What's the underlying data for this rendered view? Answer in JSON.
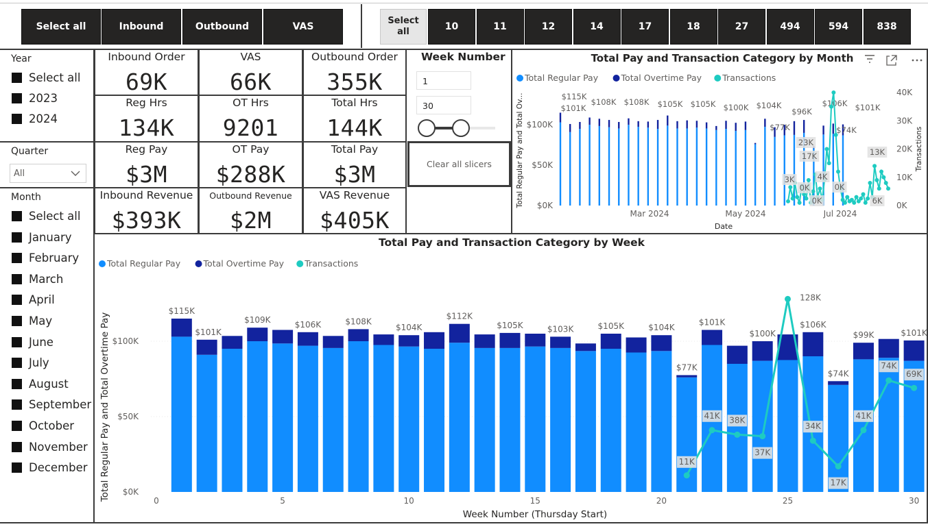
{
  "colors": {
    "regular_pay": "#118dff",
    "overtime_pay": "#12239e",
    "transactions": "#1ecbc1",
    "button_dark": "#252423",
    "button_light": "#e6e6e6",
    "divider": "#3b3b3b"
  },
  "category_buttons": [
    "Select all",
    "Inbound",
    "Outbound",
    "VAS"
  ],
  "number_buttons": {
    "select_all": "Select all",
    "values": [
      "10",
      "11",
      "12",
      "14",
      "17",
      "18",
      "27",
      "494",
      "594",
      "838"
    ]
  },
  "year_slicer": {
    "title": "Year",
    "items": [
      "Select all",
      "2023",
      "2024"
    ]
  },
  "quarter_slicer": {
    "title": "Quarter",
    "selected": "All",
    "icon": "chevron-down-icon"
  },
  "month_slicer": {
    "title": "Month",
    "items": [
      "Select all",
      "January",
      "February",
      "March",
      "April",
      "May",
      "June",
      "July",
      "August",
      "September",
      "October",
      "November",
      "December"
    ]
  },
  "kpis": [
    {
      "label": "Inbound Order",
      "value": "69K"
    },
    {
      "label": "VAS",
      "value": "66K"
    },
    {
      "label": "Outbound Order",
      "value": "355K"
    },
    {
      "label": "Reg Hrs",
      "value": "134K"
    },
    {
      "label": "OT Hrs",
      "value": "9201"
    },
    {
      "label": "Total Hrs",
      "value": "144K"
    },
    {
      "label": "Reg Pay",
      "value": "$3M"
    },
    {
      "label": "OT Pay",
      "value": "$288K"
    },
    {
      "label": "Total Pay",
      "value": "$3M"
    },
    {
      "label": "Inbound Revenue",
      "value": "$393K"
    },
    {
      "label": "Outbound Revenue",
      "value": "$2M"
    },
    {
      "label": "VAS Revenue",
      "value": "$405K"
    }
  ],
  "week_slicer": {
    "title": "Week Number",
    "min_value": "1",
    "max_value": "30",
    "range_fraction": [
      0.0,
      0.5
    ]
  },
  "clear_button": "Clear all slicers",
  "legend": [
    "Total Regular Pay",
    "Total Overtime Pay",
    "Transactions"
  ],
  "chart_data": [
    {
      "type": "bar",
      "title": "Total Pay and Transaction Category by Month",
      "xlabel": "Date",
      "ylabel": "Total Regular Pay and Total Ov...",
      "y2label": "Transactions",
      "x_ticks": [
        "Mar 2024",
        "May 2024",
        "Jul 2024"
      ],
      "y_ticks": [
        "$0K",
        "$50K",
        "$100K"
      ],
      "y2_ticks": [
        "0K",
        "10K",
        "20K",
        "30K",
        "40K"
      ],
      "ylim": [
        0,
        140000
      ],
      "y2lim": [
        0,
        40000
      ],
      "header_icons": [
        "filter-icon",
        "focus-mode-icon",
        "more-options-icon"
      ],
      "bar_labels": [
        "$115K",
        "$101K",
        "$108K",
        "$108K",
        "$105K",
        "$105K",
        "$100K",
        "$104K",
        "$77K",
        "$96K",
        "$106K",
        "$74K",
        "$101K"
      ],
      "transaction_labels": [
        "23K",
        "17K",
        "4K",
        "3K",
        "0K",
        "0K",
        "0K",
        "13K",
        "6K"
      ],
      "series": [
        {
          "name": "Total Regular Pay",
          "values": [
            103000,
            91000,
            95000,
            100000,
            98500,
            97000,
            95500,
            100000,
            97500,
            96500,
            95000,
            99000,
            95500,
            95500,
            96500,
            95500,
            93500,
            95000,
            92500,
            93500,
            76000,
            97500,
            85000,
            87000,
            87500,
            90000,
            71000,
            88000,
            89000,
            87000
          ]
        },
        {
          "name": "Total Overtime Pay",
          "values": [
            12000,
            10000,
            8500,
            9000,
            9000,
            9000,
            8000,
            8000,
            7000,
            7500,
            11000,
            12500,
            9000,
            10000,
            8500,
            7500,
            5000,
            10000,
            10000,
            10500,
            1500,
            10000,
            12000,
            13000,
            17000,
            16000,
            2500,
            11000,
            12500,
            13500
          ]
        }
      ]
    },
    {
      "type": "bar",
      "title": "Total Pay and Transaction Category by Week",
      "xlabel": "Week Number (Thursday Start)",
      "ylabel": "Total Regular Pay and Total Overtime Pay",
      "x_ticks": [
        "0",
        "5",
        "10",
        "15",
        "20",
        "25",
        "30"
      ],
      "y_ticks": [
        "$0K",
        "$50K",
        "$100K"
      ],
      "ylim": [
        0,
        140000
      ],
      "x": [
        1,
        2,
        3,
        4,
        5,
        6,
        7,
        8,
        9,
        10,
        11,
        12,
        13,
        14,
        15,
        16,
        17,
        18,
        19,
        20,
        21,
        22,
        23,
        24,
        25,
        26,
        27,
        28,
        29,
        30
      ],
      "series": [
        {
          "name": "Total Regular Pay",
          "values": [
            103000,
            91000,
            95000,
            100000,
            98500,
            97000,
            95500,
            100000,
            97500,
            96500,
            95000,
            99000,
            95500,
            95500,
            96500,
            95500,
            93500,
            95000,
            92500,
            93500,
            76000,
            97500,
            85000,
            87000,
            87500,
            90000,
            71000,
            88000,
            89000,
            87000
          ]
        },
        {
          "name": "Total Overtime Pay",
          "values": [
            12000,
            10000,
            8500,
            9000,
            9000,
            9000,
            8000,
            8000,
            7000,
            7500,
            11000,
            12500,
            9000,
            10000,
            8500,
            7500,
            5000,
            10000,
            10000,
            10500,
            1500,
            10000,
            12000,
            13000,
            17000,
            16000,
            2500,
            11000,
            12500,
            13500
          ]
        }
      ],
      "bar_labels": [
        {
          "week": 1,
          "text": "$115K"
        },
        {
          "week": 2,
          "text": "$101K"
        },
        {
          "week": 4,
          "text": "$109K"
        },
        {
          "week": 6,
          "text": "$106K"
        },
        {
          "week": 8,
          "text": "$108K"
        },
        {
          "week": 10,
          "text": "$104K"
        },
        {
          "week": 12,
          "text": "$112K"
        },
        {
          "week": 14,
          "text": "$105K"
        },
        {
          "week": 16,
          "text": "$103K"
        },
        {
          "week": 18,
          "text": "$105K"
        },
        {
          "week": 20,
          "text": "$104K"
        },
        {
          "week": 21,
          "text": "$77K"
        },
        {
          "week": 22,
          "text": "$101K"
        },
        {
          "week": 24,
          "text": "$100K"
        },
        {
          "week": 26,
          "text": "$106K"
        },
        {
          "week": 27,
          "text": "$74K"
        },
        {
          "week": 28,
          "text": "$99K"
        },
        {
          "week": 30,
          "text": "$101K"
        }
      ],
      "transactions": {
        "name": "Transactions",
        "points": [
          {
            "week": 21,
            "y": 11000,
            "label": "11K"
          },
          {
            "week": 22,
            "y": 41000,
            "label": "41K"
          },
          {
            "week": 23,
            "y": 38000,
            "label": "38K"
          },
          {
            "week": 24,
            "y": 37000,
            "label": "37K"
          },
          {
            "week": 25,
            "y": 128000,
            "label": "128K"
          },
          {
            "week": 26,
            "y": 34000,
            "label": "34K"
          },
          {
            "week": 27,
            "y": 17000,
            "label": "17K"
          },
          {
            "week": 28,
            "y": 41000,
            "label": "41K"
          },
          {
            "week": 29,
            "y": 74000,
            "label": "74K"
          },
          {
            "week": 30,
            "y": 69000,
            "label": "69K"
          }
        ]
      }
    }
  ]
}
